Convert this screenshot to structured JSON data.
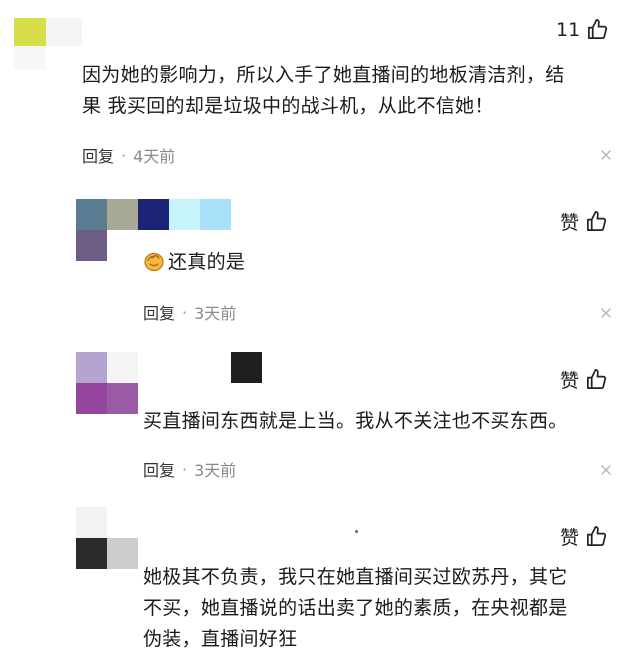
{
  "comments": [
    {
      "like_label": "11",
      "text": "因为她的影响力，所以入手了她直播间的地板清洁剂，结果 我买回的却是垃圾中的战斗机，从此不信她！",
      "text_lines": [
        "因为她的影响力，所以入手了她直播间的地板清洁剂，结",
        "果 我买回的却是垃圾中的战斗机，从此不信她！"
      ],
      "reply_label": "回复",
      "time": "4天前"
    },
    {
      "like_label": "赞",
      "text": "还真的是",
      "reply_label": "回复",
      "time": "3天前"
    },
    {
      "like_label": "赞",
      "text": "买直播间东西就是上当。我从不关注也不买东西。",
      "reply_label": "回复",
      "time": "3天前"
    },
    {
      "like_label": "赞",
      "text": "她极其不负责，我只在她直播间买过欧苏丹，其它不买，她直播说的话出卖了她的素质，在央视都是伪装，直播间好狂",
      "text_lines": [
        "她极其不负责，我只在她直播间买过欧苏丹，其它",
        "不买，她直播说的话出卖了她的素质，在央视都是",
        "伪装，直播间好狂"
      ]
    }
  ],
  "icons": {
    "like": "thumbs-up-icon",
    "close": "close-icon",
    "emoji": "clapping-hands-emoji"
  },
  "colors": {
    "text": "#1a1a1a",
    "meta_gray": "#8a8a8a",
    "background": "#ffffff"
  }
}
